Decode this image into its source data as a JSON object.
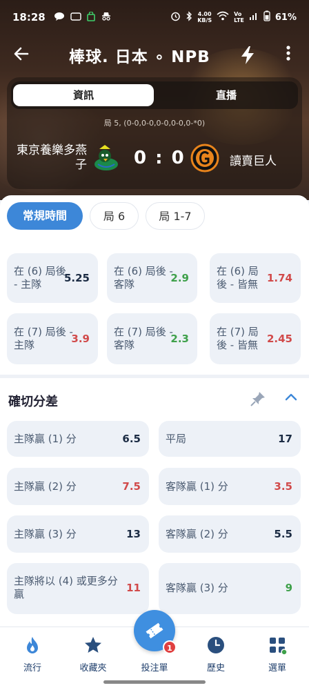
{
  "status": {
    "time": "18:28",
    "net_speed": "4.00\nKB/S",
    "battery": "61%"
  },
  "header": {
    "title": "棒球. 日本 ∘ NPB"
  },
  "match": {
    "tabs": [
      "資訊",
      "直播"
    ],
    "inning_info": "局 5, (0-0,0-0,0-0,0-0,0-*0)",
    "home_team": "東京養樂多燕子",
    "away_team": "讀賣巨人",
    "score": "0 : 0"
  },
  "periods": [
    "常規時間",
    "局 6",
    "局 1-7"
  ],
  "section1": {
    "odds": [
      {
        "label": "在 (6) 局後 - 主隊",
        "value": "5.25",
        "color": "dark"
      },
      {
        "label": "在 (6) 局後 - 客隊",
        "value": "2.9",
        "color": "green"
      },
      {
        "label": "在 (6) 局後 - 皆無",
        "value": "1.74",
        "color": "red"
      },
      {
        "label": "在 (7) 局後 - 主隊",
        "value": "3.9",
        "color": "red"
      },
      {
        "label": "在 (7) 局後 - 客隊",
        "value": "2.3",
        "color": "green"
      },
      {
        "label": "在 (7) 局後 - 皆無",
        "value": "2.45",
        "color": "red"
      }
    ]
  },
  "section2": {
    "title": "確切分差",
    "odds": [
      {
        "label": "主隊贏 (1) 分",
        "value": "6.5",
        "color": "dark"
      },
      {
        "label": "平局",
        "value": "17",
        "color": "dark"
      },
      {
        "label": "主隊贏 (2) 分",
        "value": "7.5",
        "color": "red"
      },
      {
        "label": "客隊贏 (1) 分",
        "value": "3.5",
        "color": "red"
      },
      {
        "label": "主隊贏 (3) 分",
        "value": "13",
        "color": "dark"
      },
      {
        "label": "客隊贏 (2) 分",
        "value": "5.5",
        "color": "dark"
      },
      {
        "label": "主隊將以 (4) 或更多分贏",
        "value": "11",
        "color": "red"
      },
      {
        "label": "客隊贏 (3) 分",
        "value": "9",
        "color": "green"
      }
    ]
  },
  "nav": {
    "items": [
      "流行",
      "收藏夾",
      "投注單",
      "歷史",
      "選單"
    ],
    "betslip_badge": "1"
  },
  "colors": {
    "accent": "#3d87d8",
    "red": "#d14a4a",
    "green": "#3ea04a"
  }
}
